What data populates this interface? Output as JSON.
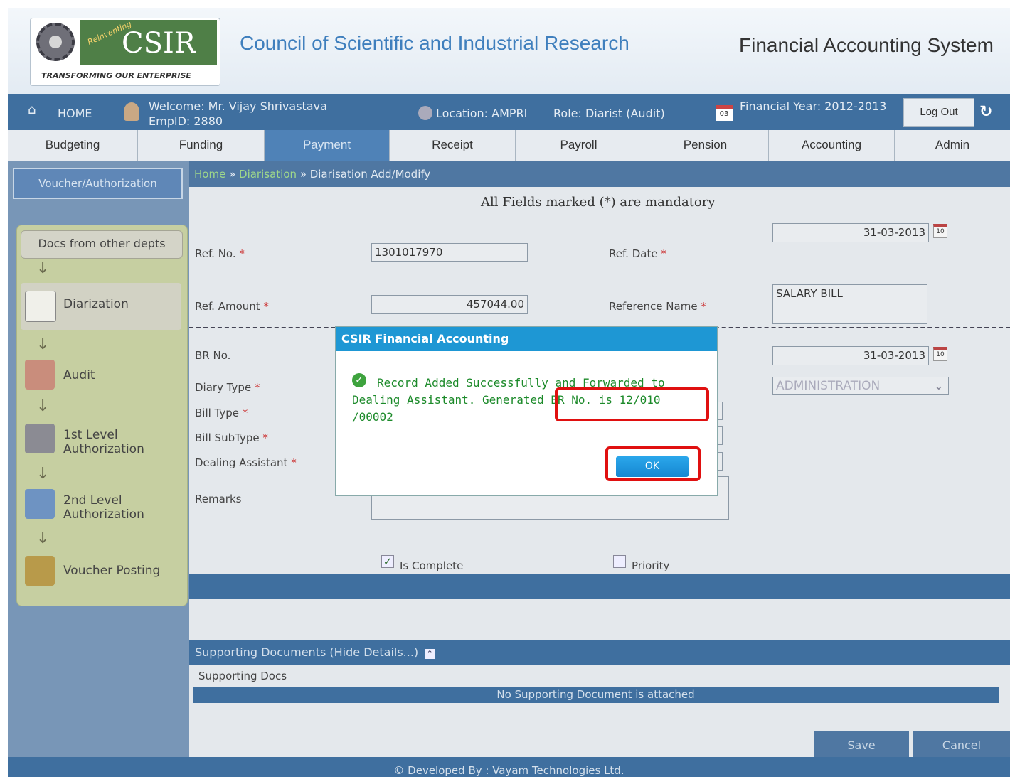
{
  "header": {
    "logo_text": "CSIR",
    "logo_reinventing": "Reinventing",
    "logo_tagline": "TRANSFORMING OUR ENTERPRISE",
    "org_title": "Council of Scientific and Industrial Research",
    "system_title": "Financial Accounting System"
  },
  "userbar": {
    "home": "HOME",
    "welcome": "Welcome: Mr. Vijay Shrivastava",
    "emp_id": "EmpID: 2880",
    "location": "Location: AMPRI",
    "role": "Role: Diarist (Audit)",
    "calendar_day": "03",
    "financial_year": "Financial Year: 2012-2013",
    "logout": "Log Out"
  },
  "nav": {
    "tabs": [
      "Budgeting",
      "Funding",
      "Payment",
      "Receipt",
      "Payroll",
      "Pension",
      "Accounting",
      "Admin"
    ],
    "active": "Payment"
  },
  "sidebar": {
    "voucher_tab": "Voucher/Authorization",
    "docs_button": "Docs from other depts",
    "steps": [
      {
        "label": "Diarization",
        "icon": "book-icon"
      },
      {
        "label": "Audit",
        "icon": "users-icon"
      },
      {
        "label": "1st Level",
        "label2": "Authorization",
        "icon": "person-icon"
      },
      {
        "label": "2nd Level",
        "label2": "Authorization",
        "icon": "person-blue-icon"
      },
      {
        "label": "Voucher Posting",
        "icon": "books-icon"
      }
    ]
  },
  "breadcrumb": {
    "home": "Home",
    "sep": " » ",
    "diarisation": "Diarisation",
    "current": "Diarisation Add/Modify"
  },
  "form": {
    "mandatory_note": "All Fields marked (*) are mandatory",
    "req_mark": " *",
    "ref_no_label": "Ref. No.",
    "ref_no_value": "1301017970",
    "ref_date_label": "Ref. Date",
    "ref_date_value": "31-03-2013",
    "ref_amount_label": "Ref. Amount",
    "ref_amount_value": "457044.00",
    "reference_name_label": "Reference Name",
    "reference_name_value": "SALARY BILL",
    "br_no_label": "BR No.",
    "br_date_value": "31-03-2013",
    "diary_type_label": "Diary Type",
    "department_value": "ADMINISTRATION",
    "bill_type_label": "Bill Type",
    "bill_subtype_label": "Bill SubType",
    "dealing_assistant_label": "Dealing Assistant",
    "remarks_label": "Remarks",
    "is_complete_label": "Is Complete",
    "is_complete_checked": true,
    "priority_label": "Priority",
    "calendar_day": "10"
  },
  "supporting": {
    "header": "Supporting Documents (Hide Details...)",
    "label": "Supporting Docs",
    "empty_message": "No Supporting Document is attached"
  },
  "actions": {
    "save": "Save",
    "cancel": "Cancel"
  },
  "footer": {
    "text": "© Developed By : Vayam Technologies Ltd."
  },
  "modal": {
    "title": "CSIR Financial Accounting",
    "line1": "Record Added Successfully and Forwarded to",
    "line2": "Dealing Assistant. Generated BR No. is 12/010",
    "line3": "/00002",
    "ok": "OK"
  },
  "colors": {
    "accent_blue": "#3f6f9f",
    "modal_title": "#1e97d4",
    "success_green": "#1c8a2a",
    "highlight_red": "#e01010"
  }
}
